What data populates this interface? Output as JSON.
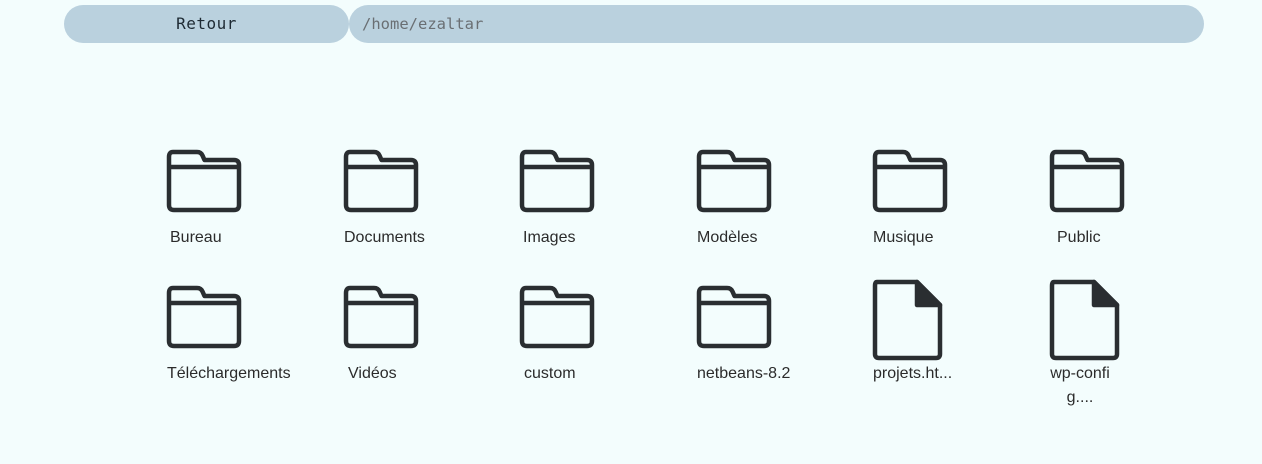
{
  "toolbar": {
    "back_label": "Retour",
    "path_value": "/home/ezaltar"
  },
  "colors": {
    "background": "#f3fdfd",
    "bar": "#bad1de",
    "icon_stroke": "#2a2e31"
  },
  "items": [
    {
      "label": "Bureau",
      "icon": "folder-icon"
    },
    {
      "label": "Documents",
      "icon": "folder-icon"
    },
    {
      "label": "Images",
      "icon": "folder-icon"
    },
    {
      "label": "Modèles",
      "icon": "folder-icon"
    },
    {
      "label": "Musique",
      "icon": "folder-icon"
    },
    {
      "label": "Public",
      "icon": "folder-icon"
    },
    {
      "label": "Téléchargements",
      "icon": "folder-icon"
    },
    {
      "label": "Vidéos",
      "icon": "folder-icon"
    },
    {
      "label": "custom",
      "icon": "folder-icon"
    },
    {
      "label": "netbeans-8.2",
      "icon": "folder-icon"
    },
    {
      "label": "projets.ht...",
      "icon": "file-icon"
    },
    {
      "label": "wp-config....",
      "icon": "file-icon"
    }
  ]
}
